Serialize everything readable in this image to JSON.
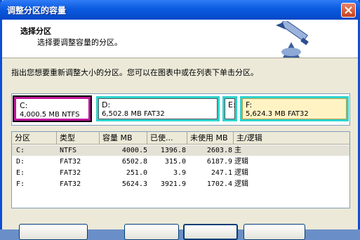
{
  "window": {
    "title": "调整分区的容量"
  },
  "header": {
    "title": "选择分区",
    "subtitle": "选择要调整容量的分区。",
    "icon": "resize-tool-icon"
  },
  "instruction": "指出您想要重新调整大小的分区。您可以在图表中或在列表下单击分区。",
  "partitions": [
    {
      "label": "C:",
      "info": "4,000.5 MB    NTFS",
      "color": "#c0149a"
    },
    {
      "label": "D:",
      "info": "6,502.8 MB    FAT32",
      "color": "#2fd3cf"
    },
    {
      "label": "E:",
      "info": "",
      "color": "#2fd3cf"
    },
    {
      "label": "F:",
      "info": "5,624.3 MB    FAT32",
      "color": "#2fd3cf"
    }
  ],
  "table": {
    "columns": [
      "分区",
      "类型",
      "容量 MB",
      "已使...",
      "未使用 MB",
      "主/逻辑"
    ],
    "rows": [
      {
        "partition": "C:",
        "type": "NTFS",
        "capacity": "4000.5",
        "used": "1396.8",
        "unused": "2603.8",
        "kind": "主"
      },
      {
        "partition": "D:",
        "type": "FAT32",
        "capacity": "6502.8",
        "used": "315.0",
        "unused": "6187.9",
        "kind": "逻辑"
      },
      {
        "partition": "E:",
        "type": "FAT32",
        "capacity": "251.0",
        "used": "3.9",
        "unused": "247.1",
        "kind": "逻辑"
      },
      {
        "partition": "F:",
        "type": "FAT32",
        "capacity": "5624.3",
        "used": "3921.9",
        "unused": "1702.4",
        "kind": "逻辑"
      }
    ]
  }
}
